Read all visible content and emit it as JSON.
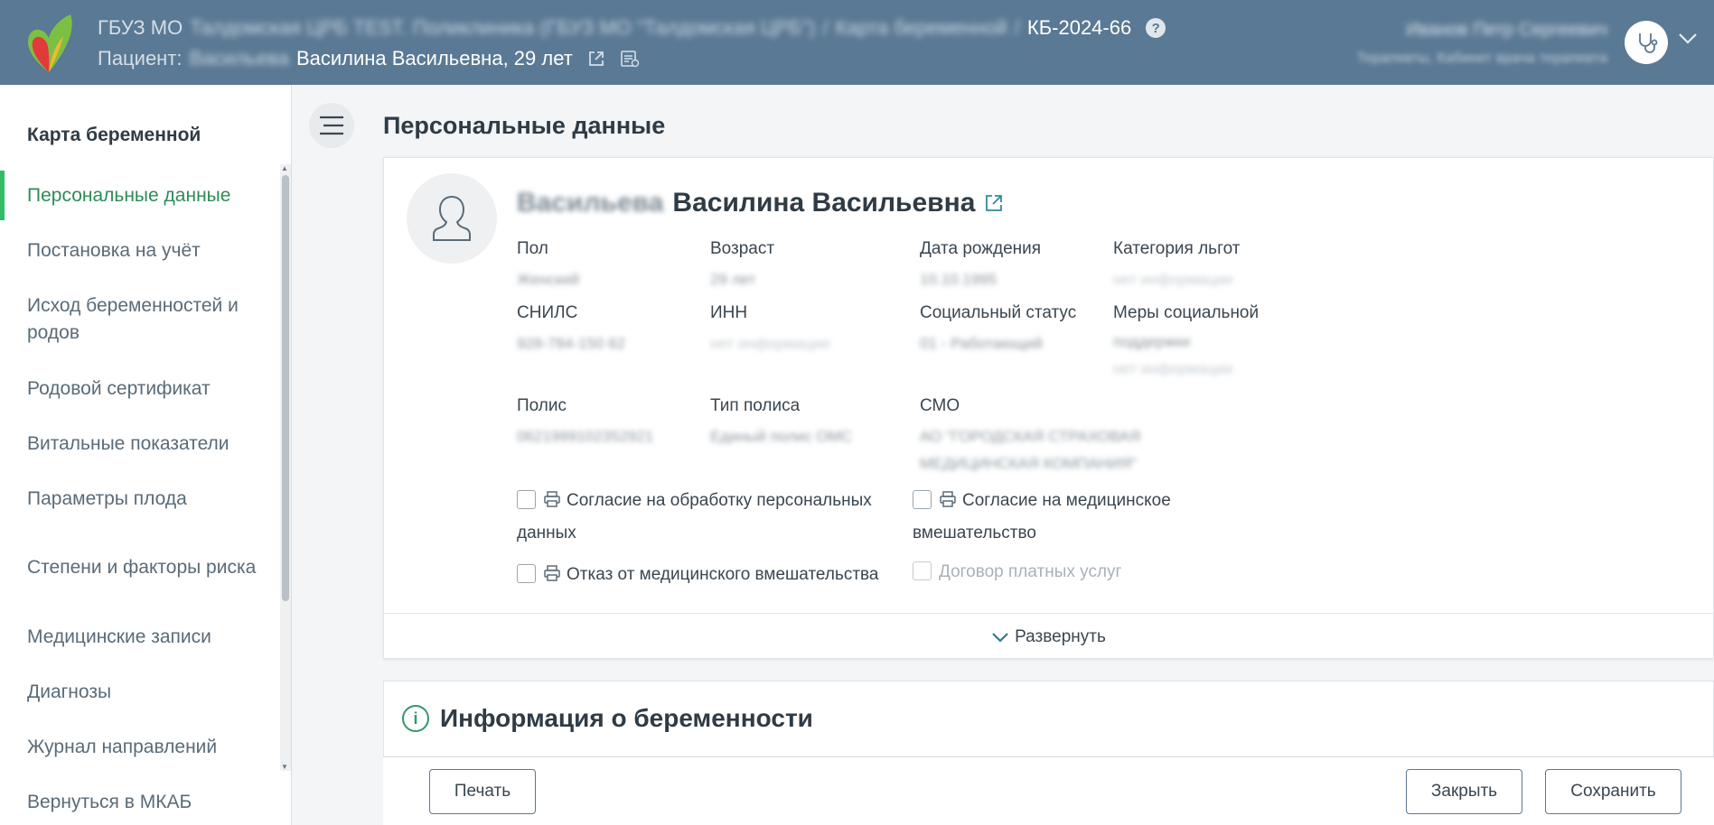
{
  "header": {
    "org": "ГБУЗ МО",
    "org_detail": "Талдомская ЦРБ TEST. Поликлиника (ГБУЗ МО \"Талдомская ЦРБ\")",
    "breadcrumb_section": "Карта беременной",
    "separator": "/",
    "card_number": "КБ-2024-66",
    "patient_label": "Пациент:",
    "patient_surname": "Васильева",
    "patient_name": "Василина Васильевна, 29 лет",
    "user_name": "Иванов Петр Сергеевич",
    "user_role": "Терапевты, Кабинет врача терапевта"
  },
  "sidebar": {
    "title": "Карта беременной",
    "items": [
      {
        "label": "Персональные данные"
      },
      {
        "label": "Постановка на учёт"
      },
      {
        "label": "Исход беременностей и родов"
      },
      {
        "label": "Родовой сертификат"
      },
      {
        "label": "Витальные показатели"
      },
      {
        "label": "Параметры плода"
      },
      {
        "label": "Степени и факторы риска"
      },
      {
        "label": "Медицинские записи"
      },
      {
        "label": "Диагнозы"
      },
      {
        "label": "Журнал направлений"
      },
      {
        "label": "Вернуться в МКАБ"
      }
    ]
  },
  "main": {
    "page_title": "Персональные данные",
    "patient": {
      "surname": "Васильева",
      "name": "Василина Васильевна"
    },
    "fields": {
      "gender": {
        "label": "Пол",
        "value": "Женский"
      },
      "age": {
        "label": "Возраст",
        "value": "29 лет"
      },
      "birth_date": {
        "label": "Дата рождения",
        "value": "10.10.1995"
      },
      "benefits": {
        "label": "Категория льгот",
        "value": "нет информации"
      },
      "snils": {
        "label": "СНИЛС",
        "value": "928-784-150 62"
      },
      "inn": {
        "label": "ИНН",
        "value": "нет информации"
      },
      "social_status": {
        "label": "Социальный статус",
        "value": "01 - Работающий"
      },
      "social_support": {
        "label": "Меры социальной",
        "label2": "поддержки",
        "value": "нет информации"
      },
      "policy": {
        "label": "Полис",
        "value": "0621999102352921"
      },
      "policy_type": {
        "label": "Тип полиса",
        "value": "Единый полис ОМС"
      },
      "smo": {
        "label": "СМО",
        "value": "АО \"ГОРОДСКАЯ СТРАХОВАЯ",
        "value2": "МЕДИЦИНСКАЯ КОМПАНИЯ\""
      }
    },
    "consents": {
      "personal_data_1": "Согласие на обработку персональных",
      "personal_data_2": "данных",
      "medical_1": "Согласие на медицинское",
      "medical_2": "вмешательство",
      "refusal": "Отказ от медицинского вмешательства",
      "paid_contract": "Договор платных услуг"
    },
    "expand_label": "Развернуть",
    "pregnancy_info_title": "Информация о беременности"
  },
  "footer": {
    "print_label": "Печать",
    "close_label": "Закрыть",
    "save_label": "Сохранить"
  },
  "colors": {
    "header_bg": "#5a7994",
    "active_green": "#2e8b57",
    "accent_bar": "#2fbd66"
  }
}
